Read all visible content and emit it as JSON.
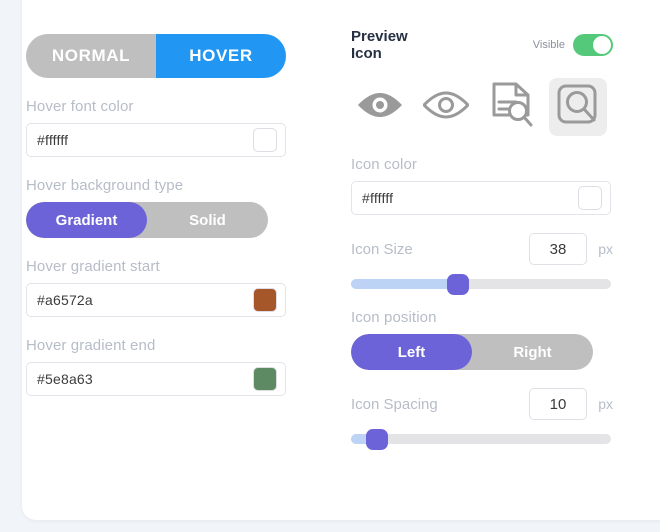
{
  "theme": {
    "page_bg": "#f1f5f9",
    "card_bg": "#ffffff",
    "accent_purple": "#6c63d8",
    "accent_blue": "#2196f3",
    "toggle_green": "#55c97a",
    "muted_gray": "#bfbfbf",
    "label_gray": "#b6bcc8",
    "slider_fill": "#bcd3f5",
    "slider_track": "#e4e4e6"
  },
  "left": {
    "state_tabs": {
      "normal_label": "NORMAL",
      "hover_label": "HOVER",
      "active": "HOVER"
    },
    "hover_font_color": {
      "label": "Hover font color",
      "value": "#ffffff",
      "swatch": "#ffffff"
    },
    "hover_background_type": {
      "label": "Hover background type",
      "gradient_label": "Gradient",
      "solid_label": "Solid",
      "active": "Gradient"
    },
    "hover_gradient_start": {
      "label": "Hover gradient start",
      "value": "#a6572a",
      "swatch": "#a6572a"
    },
    "hover_gradient_end": {
      "label": "Hover gradient end",
      "value": "#5e8a63",
      "swatch": "#5e8a63"
    }
  },
  "right": {
    "preview": {
      "title": "Preview Icon",
      "visible_label": "Visible",
      "visible_on": true
    },
    "icon_choices": [
      {
        "name": "eye-filled-icon",
        "selected": false
      },
      {
        "name": "eye-outline-icon",
        "selected": false
      },
      {
        "name": "document-search-icon",
        "selected": false
      },
      {
        "name": "boxed-search-icon",
        "selected": true
      }
    ],
    "icon_color": {
      "label": "Icon color",
      "value": "#ffffff",
      "swatch": "#ffffff"
    },
    "icon_size": {
      "label": "Icon Size",
      "value": "38",
      "unit": "px",
      "fill_percent": 41
    },
    "icon_position": {
      "label": "Icon position",
      "left_label": "Left",
      "right_label": "Right",
      "active": "Left"
    },
    "icon_spacing": {
      "label": "Icon Spacing",
      "value": "10",
      "unit": "px",
      "fill_percent": 10
    }
  }
}
